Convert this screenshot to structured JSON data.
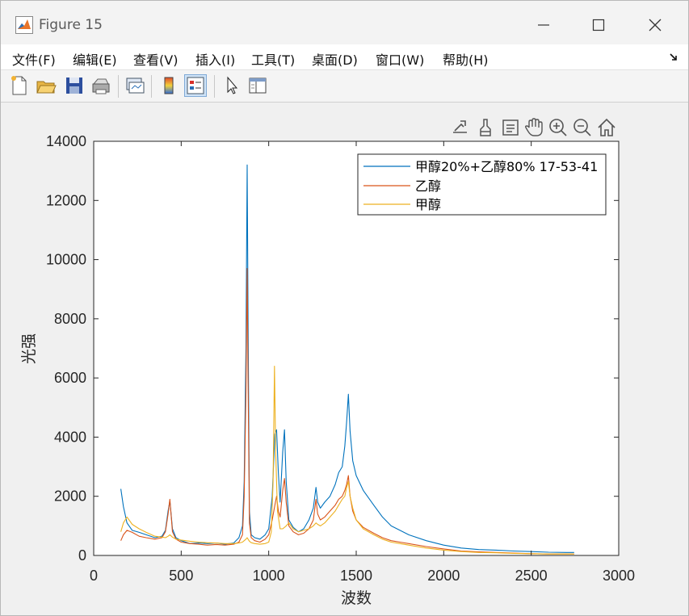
{
  "window": {
    "title": "Figure 15",
    "controls": [
      "minimize",
      "maximize",
      "close"
    ]
  },
  "menu": {
    "items": [
      "文件(F)",
      "编辑(E)",
      "查看(V)",
      "插入(I)",
      "工具(T)",
      "桌面(D)",
      "窗口(W)",
      "帮助(H)"
    ]
  },
  "toolbar": {
    "buttons": [
      "new-figure-icon",
      "open-folder-icon",
      "save-icon",
      "print-icon",
      "link-plot-icon",
      "colorbar-icon",
      "legend-icon",
      "pointer-icon",
      "property-inspector-icon"
    ],
    "active": "legend-icon"
  },
  "axes_toolbar": {
    "buttons": [
      "export-icon",
      "brush-icon",
      "datatip-icon",
      "pan-icon",
      "zoom-in-icon",
      "zoom-out-icon",
      "home-icon"
    ]
  },
  "colors": {
    "series1": "#0072BD",
    "series2": "#D95319",
    "series3": "#EDB120"
  },
  "chart_data": {
    "type": "line",
    "title": "",
    "xlabel": "波数",
    "ylabel": "光强",
    "xlim": [
      0,
      3000
    ],
    "ylim": [
      0,
      14000
    ],
    "xticks": [
      0,
      500,
      1000,
      1500,
      2000,
      2500,
      3000
    ],
    "yticks": [
      0,
      2000,
      4000,
      6000,
      8000,
      10000,
      12000,
      14000
    ],
    "xtick_labels": [
      "0",
      "500",
      "1000",
      "1500",
      "2000",
      "2500",
      "3000"
    ],
    "ytick_labels": [
      "0",
      "2000",
      "4000",
      "6000",
      "8000",
      "10000",
      "12000",
      "14000"
    ],
    "grid": false,
    "legend_position": "top-right",
    "series": [
      {
        "name": "甲醇20%+乙醇80% 17-53-41",
        "color": "#0072BD",
        "x": [
          155,
          170,
          190,
          220,
          260,
          300,
          350,
          390,
          410,
          425,
          435,
          450,
          470,
          500,
          550,
          600,
          650,
          700,
          750,
          800,
          830,
          850,
          860,
          870,
          877,
          882,
          890,
          900,
          920,
          950,
          980,
          1000,
          1020,
          1035,
          1045,
          1055,
          1065,
          1080,
          1090,
          1100,
          1115,
          1140,
          1170,
          1200,
          1230,
          1255,
          1270,
          1280,
          1295,
          1320,
          1350,
          1380,
          1400,
          1420,
          1435,
          1445,
          1455,
          1465,
          1480,
          1500,
          1540,
          1600,
          1650,
          1700,
          1750,
          1800,
          1900,
          2000,
          2100,
          2200,
          2300,
          2400,
          2500,
          2600,
          2700,
          2745
        ],
        "y": [
          2250,
          1650,
          1100,
          850,
          780,
          700,
          600,
          650,
          850,
          1500,
          1850,
          900,
          600,
          500,
          400,
          420,
          400,
          420,
          380,
          420,
          600,
          1000,
          2500,
          7000,
          13200,
          8000,
          1500,
          700,
          600,
          550,
          700,
          900,
          2000,
          4100,
          4250,
          2800,
          1800,
          3500,
          4250,
          2500,
          1200,
          950,
          800,
          900,
          1200,
          1600,
          2300,
          1800,
          1600,
          1800,
          2000,
          2400,
          2800,
          3000,
          3700,
          4500,
          5450,
          4200,
          3200,
          2700,
          2200,
          1700,
          1300,
          1000,
          850,
          700,
          500,
          350,
          250,
          200,
          180,
          150,
          130,
          110,
          100,
          100
        ]
      },
      {
        "name": "乙醇",
        "color": "#D95319",
        "x": [
          155,
          170,
          190,
          220,
          260,
          300,
          350,
          390,
          410,
          425,
          435,
          450,
          470,
          500,
          550,
          600,
          650,
          700,
          750,
          800,
          830,
          850,
          860,
          870,
          877,
          882,
          890,
          900,
          920,
          950,
          980,
          1000,
          1020,
          1035,
          1045,
          1055,
          1065,
          1080,
          1090,
          1100,
          1115,
          1140,
          1170,
          1200,
          1230,
          1255,
          1270,
          1280,
          1295,
          1320,
          1350,
          1380,
          1400,
          1420,
          1435,
          1445,
          1455,
          1465,
          1480,
          1500,
          1540,
          1600,
          1650,
          1700,
          1750,
          1800,
          1900,
          2000,
          2100,
          2200,
          2300,
          2400,
          2500,
          2600,
          2700,
          2745
        ],
        "y": [
          500,
          700,
          850,
          780,
          650,
          600,
          550,
          600,
          800,
          1400,
          1900,
          800,
          550,
          450,
          400,
          380,
          350,
          370,
          350,
          380,
          450,
          700,
          2000,
          5500,
          9700,
          6000,
          1100,
          600,
          500,
          450,
          550,
          700,
          1200,
          1700,
          2000,
          1500,
          1300,
          2200,
          2600,
          1800,
          1000,
          800,
          700,
          750,
          900,
          1200,
          1900,
          1400,
          1200,
          1300,
          1500,
          1700,
          1900,
          2000,
          2200,
          2400,
          2700,
          2000,
          1500,
          1200,
          950,
          750,
          600,
          500,
          450,
          400,
          300,
          220,
          150,
          120,
          100,
          80,
          60,
          50,
          50,
          50
        ]
      },
      {
        "name": "甲醇",
        "color": "#EDB120",
        "x": [
          155,
          170,
          190,
          220,
          260,
          300,
          350,
          390,
          410,
          425,
          435,
          450,
          470,
          500,
          550,
          600,
          650,
          700,
          750,
          800,
          830,
          850,
          860,
          870,
          877,
          882,
          890,
          900,
          920,
          950,
          980,
          1000,
          1015,
          1025,
          1033,
          1040,
          1050,
          1065,
          1080,
          1100,
          1115,
          1140,
          1170,
          1200,
          1230,
          1255,
          1270,
          1280,
          1295,
          1320,
          1350,
          1380,
          1400,
          1420,
          1435,
          1445,
          1455,
          1465,
          1480,
          1500,
          1540,
          1600,
          1650,
          1700,
          1750,
          1800,
          1900,
          2000,
          2100,
          2200,
          2300,
          2400,
          2500,
          2600,
          2700,
          2745
        ],
        "y": [
          800,
          1100,
          1300,
          1050,
          900,
          780,
          650,
          620,
          600,
          650,
          700,
          620,
          550,
          520,
          480,
          450,
          430,
          420,
          400,
          400,
          420,
          450,
          500,
          550,
          600,
          550,
          480,
          430,
          400,
          380,
          400,
          450,
          800,
          2500,
          6400,
          3500,
          1500,
          900,
          900,
          1000,
          1100,
          900,
          800,
          850,
          900,
          1000,
          1100,
          1050,
          1000,
          1100,
          1300,
          1500,
          1700,
          1900,
          2000,
          2300,
          2500,
          2000,
          1600,
          1200,
          900,
          700,
          550,
          450,
          400,
          350,
          250,
          180,
          130,
          100,
          90,
          70,
          60,
          50,
          50,
          50
        ]
      }
    ]
  }
}
